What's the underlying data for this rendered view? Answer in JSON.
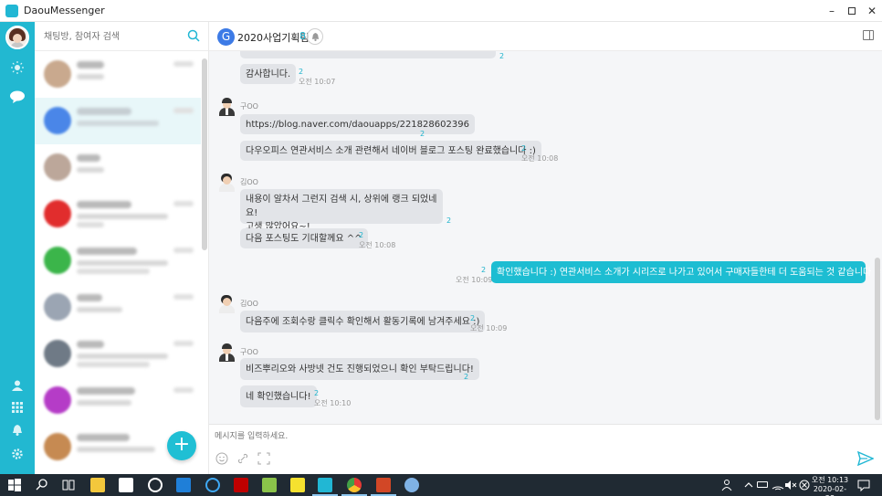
{
  "window": {
    "title": "DaouMessenger"
  },
  "sidebar": {
    "search_placeholder": "채팅방, 참여자 검색",
    "new_chat_label": "+"
  },
  "room": {
    "title": "2020사업기획팀",
    "member_count": "8",
    "avatar_letter": "G",
    "composer_placeholder": "메시지를 입력하세요."
  },
  "messages": [
    {
      "sender": "",
      "text": "감사합니다.",
      "unread": "2",
      "time": "오전 10:07"
    },
    {
      "sender": "구OO",
      "text": "https://blog.naver.com/daouapps/221828602396",
      "unread": "2",
      "time": ""
    },
    {
      "sender": "",
      "text": "다우오피스 연관서비스 소개 관련해서 네이버 블로그 포스팅 완료했습니다 :)",
      "unread": "2",
      "time": "오전 10:08"
    },
    {
      "sender": "김OO",
      "text_line1": "내용이 알차서 그런지  검색 시,  상위에 랭크 되었네요!",
      "text_line2": "고생 많았어요~!",
      "unread": "2",
      "time": ""
    },
    {
      "sender": "",
      "text": "다음 포스팅도 기대할께요 ^^",
      "unread": "2",
      "time": "오전 10:08"
    },
    {
      "sender": "me",
      "text": "확인했습니다 :) 연관서비스 소개가 시리즈로 나가고 있어서 구매자들한테 더 도움되는 것 같습니다 ㅎㅎ",
      "unread": "2",
      "time": "오전 10:09"
    },
    {
      "sender": "김OO",
      "text": "다음주에 조회수랑 클릭수 확인해서 활동기록에 남겨주세요 :)",
      "unread": "2",
      "time": "오전 10:09"
    },
    {
      "sender": "구OO",
      "text": "비즈뿌리오와 사방넷 건도 진행되었으니 확인 부탁드립니다!",
      "unread": "2",
      "time": ""
    },
    {
      "sender": "",
      "text": "네 확인했습니다!",
      "unread": "2",
      "time": "오전 10:10"
    }
  ],
  "taskbar": {
    "time": "오전 10:13",
    "date": "2020-02-28"
  },
  "colors": {
    "accent": "#1dbdd2",
    "rail": "#22b8d1",
    "taskbar": "#202a33"
  }
}
